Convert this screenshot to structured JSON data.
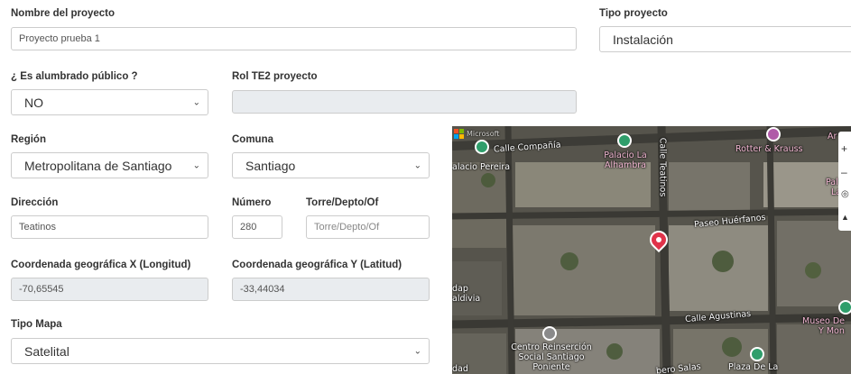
{
  "form": {
    "nombre": {
      "label": "Nombre del proyecto",
      "value": "Proyecto prueba 1"
    },
    "tipo_proyecto": {
      "label": "Tipo proyecto",
      "value": "Instalación"
    },
    "alumbrado": {
      "label": "¿ Es alumbrado público ?",
      "value": "NO"
    },
    "rol_te2": {
      "label": "Rol TE2 proyecto",
      "value": ""
    },
    "region": {
      "label": "Región",
      "value": "Metropolitana de Santiago"
    },
    "comuna": {
      "label": "Comuna",
      "value": "Santiago"
    },
    "direccion": {
      "label": "Dirección",
      "value": "Teatinos"
    },
    "numero": {
      "label": "Número",
      "value": "280"
    },
    "torre": {
      "label": "Torre/Depto/Of",
      "placeholder": "Torre/Depto/Of"
    },
    "coord_x": {
      "label": "Coordenada geográfica X (Longitud)",
      "value": "-70,65545"
    },
    "coord_y": {
      "label": "Coordenada geográfica Y (Latitud)",
      "value": "-33,44034"
    },
    "tipo_mapa": {
      "label": "Tipo Mapa",
      "value": "Satelital"
    }
  },
  "map": {
    "provider": "Microsoft",
    "labels": {
      "calle_compania": "Calle Compañía",
      "palacio_pereira": "alacio Pereira",
      "palacio_alhambra": "Palacio La Alhambra",
      "calle_teatinos": "Calle Teatinos",
      "rotter": "Rotter & Krauss",
      "paseo_huerfanos": "Paseo Huérfanos",
      "calle_agustinas": "Calle Agustinas",
      "centro_reinsercion": "Centro Reinserción Social Santiago Poniente",
      "museo": "Museo De",
      "museo_2": "Y Mon",
      "plaza": "Plaza De La",
      "salas": "bero Salas",
      "dap": "dap",
      "aldivia": "aldivia",
      "left_cut": "dad",
      "right_top": "Ar",
      "right_pal": "Pal",
      "right_la": "La"
    },
    "colors": {
      "pin_red": "#e0334a",
      "poi_green": "#2f9e6b",
      "poi_pink": "#b05aa8"
    }
  }
}
